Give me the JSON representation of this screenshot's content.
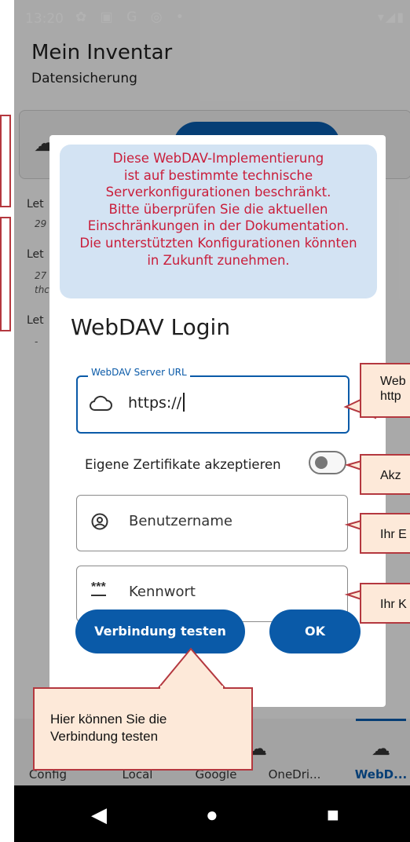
{
  "status_bar": {
    "time": "13:20",
    "icons": "✿ ▣ G ◎ •",
    "right": "▾◢▮"
  },
  "app_bar": {
    "title": "Mein Inventar",
    "subtitle": "Datensicherung"
  },
  "background_list": {
    "rows": [
      {
        "label": "Let",
        "detail": "29"
      },
      {
        "label": "Let",
        "detail": "27",
        "detail2": "thc"
      },
      {
        "label": "Let",
        "detail": "-"
      }
    ]
  },
  "dialog": {
    "info_banner": "Diese WebDAV-Implementierung ist auf bestimmte technische Serverkonfigurationen beschränkt. Bitte überprüfen Sie die aktuellen Einschränkungen in der Dokumentation. Die unterstützten Konfigurationen könnten in Zukunft zunehmen.",
    "info_banner_lines": [
      "Diese WebDAV-Implementierung",
      "ist auf bestimmte technische",
      "Serverkonfigurationen beschränkt.",
      "Bitte überprüfen Sie die aktuellen",
      "Einschränkungen in der Dokumentation.",
      "Die unterstützten Konfigurationen könnten",
      "in Zukunft zunehmen."
    ],
    "title": "WebDAV Login",
    "url_field": {
      "label": "WebDAV Server URL",
      "value": "https://",
      "icon": "cloud-icon"
    },
    "cert_toggle": {
      "label": "Eigene Zertifikate akzeptieren",
      "checked": false
    },
    "username_field": {
      "placeholder": "Benutzername",
      "icon": "account-circle-icon"
    },
    "password_field": {
      "placeholder": "Kennwort",
      "icon": "password-icon",
      "icon_text": "***"
    },
    "test_button": "Verbindung testen",
    "ok_button": "OK"
  },
  "bottom_nav": {
    "items": [
      {
        "label": "Config"
      },
      {
        "label": "Local"
      },
      {
        "label": "Google"
      },
      {
        "label": "OneDri..."
      },
      {
        "label": "WebD..."
      }
    ],
    "active": "WebD..."
  },
  "callouts": {
    "url": [
      "Web",
      "http"
    ],
    "cert": "Akz",
    "username": "Ihr E",
    "password": "Ihr K",
    "test": [
      "Hier können Sie die",
      "Verbindung testen"
    ]
  },
  "colors": {
    "primary": "#0a5aa8",
    "warning_text": "#c91d3a",
    "banner_bg": "#d3e3f3",
    "callout_bg": "#fde9d9",
    "callout_border": "#b4383f"
  }
}
